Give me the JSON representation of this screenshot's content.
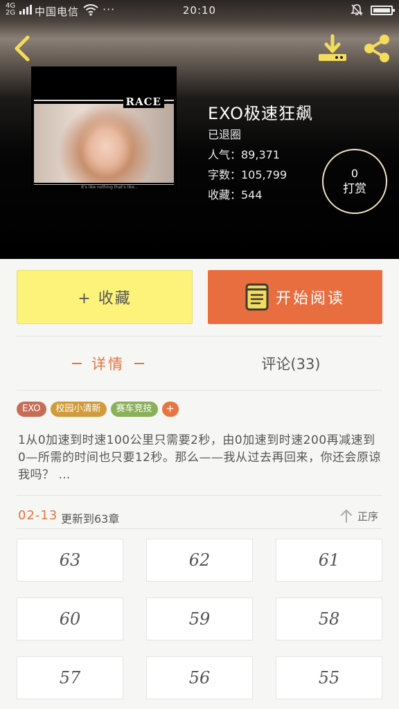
{
  "status_bar": {
    "network": "4G\n2G",
    "carrier": "中国电信",
    "more": "···",
    "time": "20:10"
  },
  "book": {
    "cover_title": "RACE",
    "cover_caption": "It's like nothing that's like...",
    "title": "EXO极速狂飙",
    "status": "已退圈",
    "popularity": "人气：89,371",
    "word_count": "字数：105,799",
    "favorites": "收藏：544"
  },
  "reward": {
    "count": "0",
    "label": "打赏"
  },
  "actions": {
    "collect_label": "+ 收藏",
    "read_label": "开始阅读"
  },
  "tabs": {
    "detail_label": "详情",
    "comments_label": "评论(33)"
  },
  "tags": [
    {
      "label": "EXO",
      "color": "#c86d55"
    },
    {
      "label": "校园小清新",
      "color": "#d29a3a"
    },
    {
      "label": "赛车竞技",
      "color": "#8ab05a"
    }
  ],
  "tag_more": "+",
  "synopsis": "1从0加速到时速100公里只需要2秒，由0加速到时速200再减速到0—所需的时间也只要12秒。那么——我从过去再回来，你还会原谅我吗？ …",
  "update": {
    "date": "02-13",
    "text": "更新到63章"
  },
  "sort_label": "正序",
  "chapters": [
    "63",
    "62",
    "61",
    "60",
    "59",
    "58",
    "57",
    "56",
    "55"
  ],
  "colors": {
    "accent": "#e8743f",
    "collect_bg": "#fdf37b",
    "read_bg": "#e86e3f",
    "icon_yellow": "#f4dc5c"
  },
  "icons": [
    "back-icon",
    "download-icon",
    "share-icon",
    "book-icon",
    "arrow-up-icon",
    "wifi-icon",
    "mute-icon",
    "battery-icon"
  ]
}
